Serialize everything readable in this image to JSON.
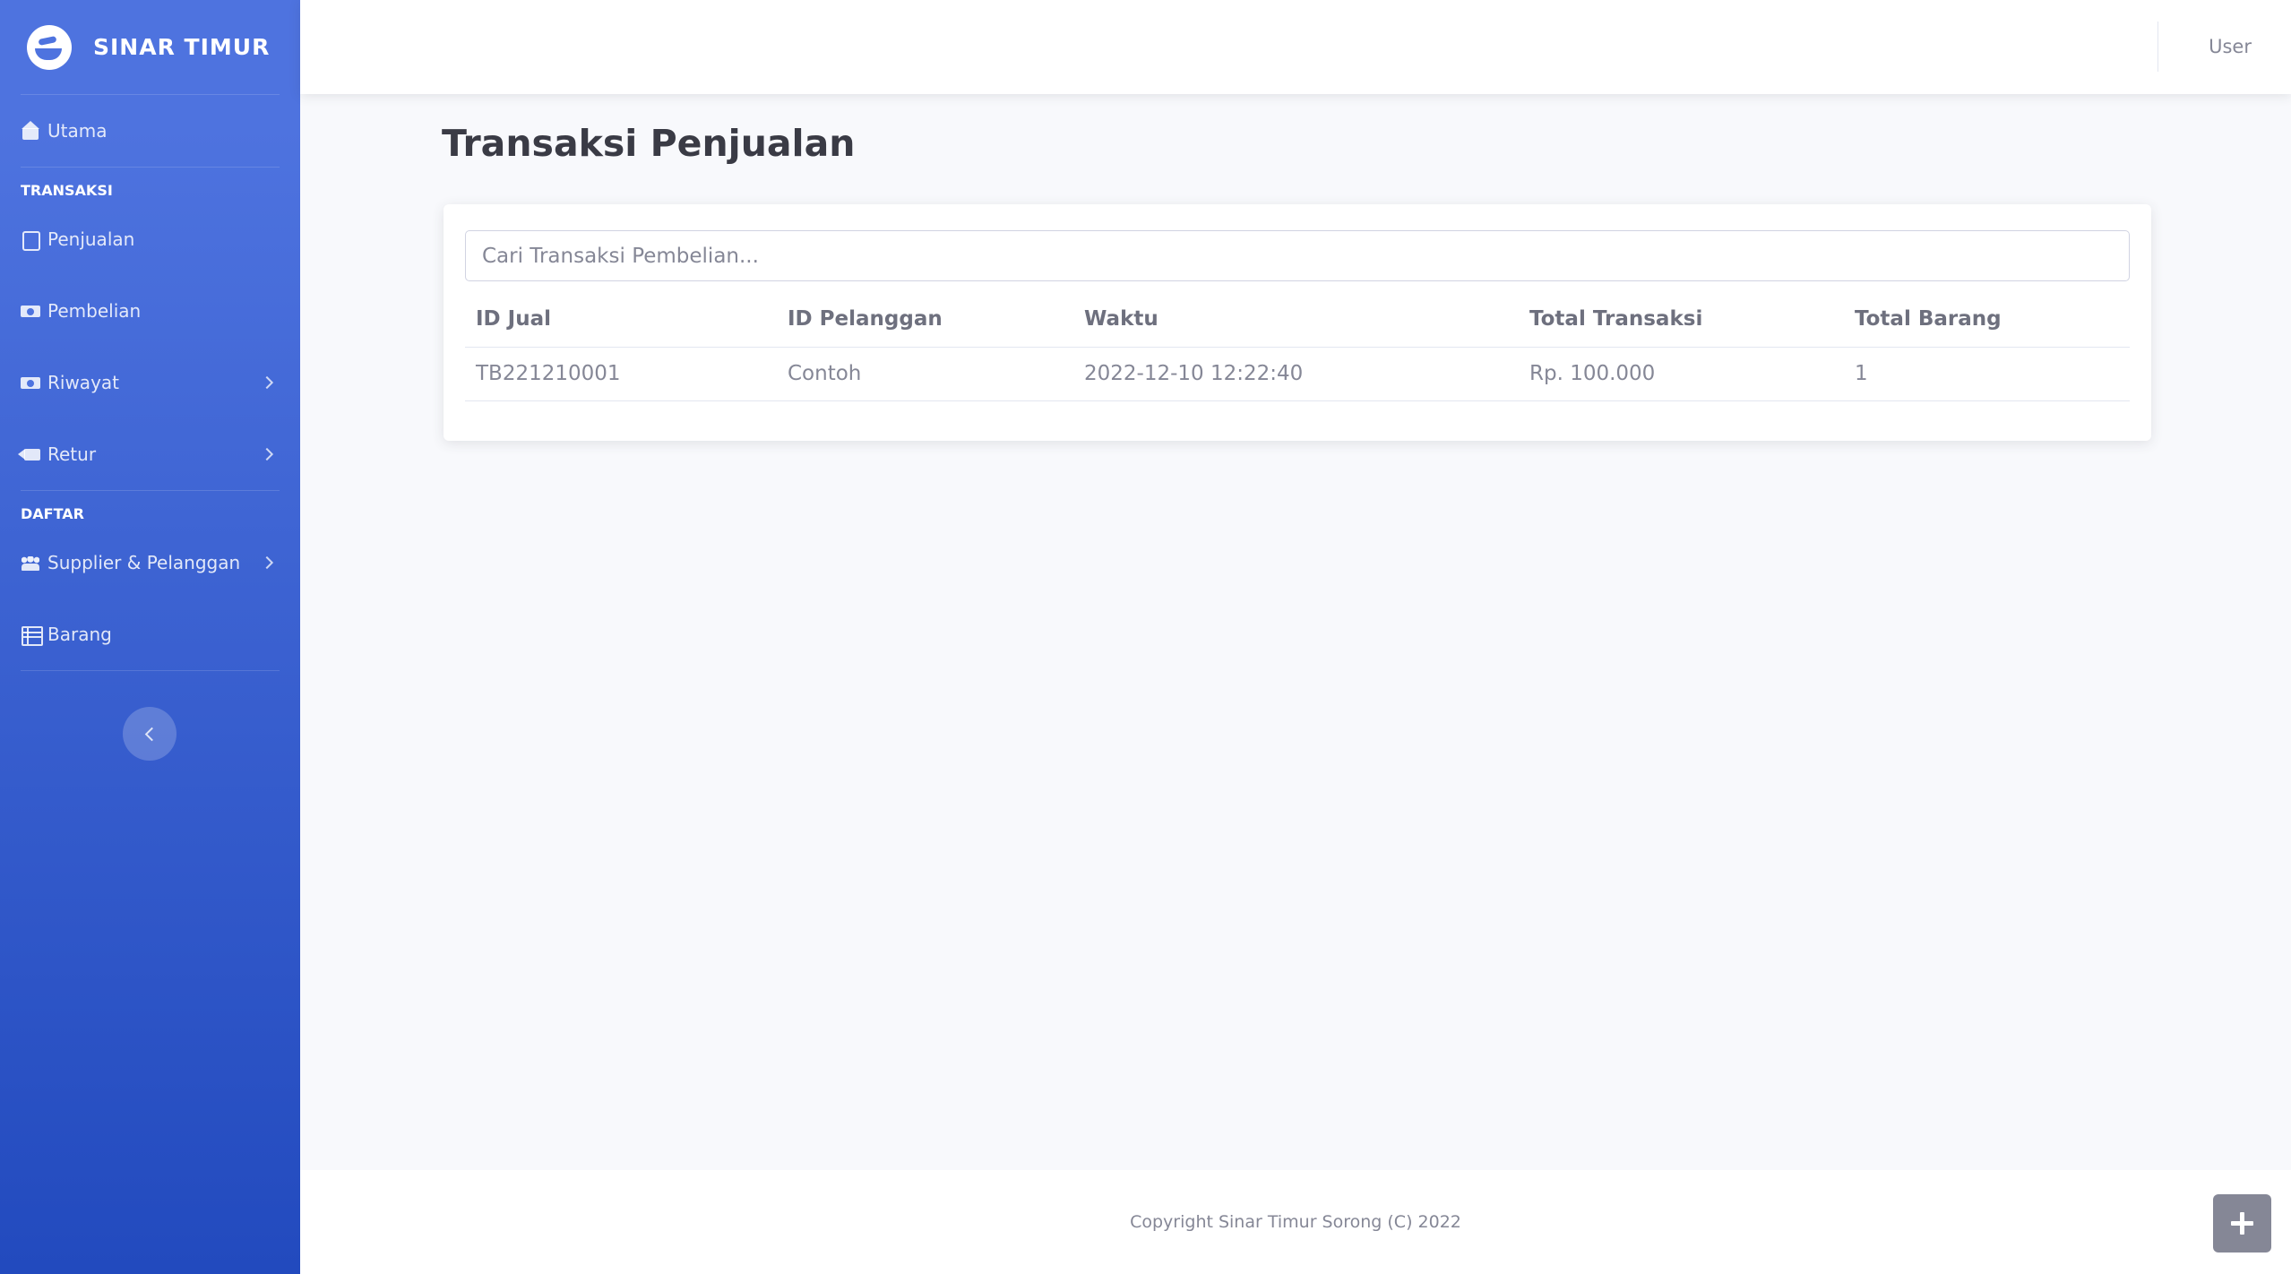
{
  "brand": {
    "name": "SINAR TIMUR"
  },
  "sidebar": {
    "home": {
      "label": "Utama",
      "icon": "home-icon"
    },
    "sections": [
      {
        "heading": "TRANSAKSI",
        "items": [
          {
            "label": "Penjualan",
            "icon": "note-icon",
            "has_submenu": false
          },
          {
            "label": "Pembelian",
            "icon": "money-icon",
            "has_submenu": false
          },
          {
            "label": "Riwayat",
            "icon": "money-icon",
            "has_submenu": true
          },
          {
            "label": "Retur",
            "icon": "backspace-icon",
            "has_submenu": true
          }
        ]
      },
      {
        "heading": "DAFTAR",
        "items": [
          {
            "label": "Supplier & Pelanggan",
            "icon": "users-icon",
            "has_submenu": true
          },
          {
            "label": "Barang",
            "icon": "table-icon",
            "has_submenu": false
          }
        ]
      }
    ]
  },
  "topbar": {
    "user": "User"
  },
  "main": {
    "title": "Transaksi Penjualan",
    "search": {
      "placeholder": "Cari Transaksi Pembelian...",
      "value": ""
    },
    "table": {
      "columns": [
        "ID Jual",
        "ID Pelanggan",
        "Waktu",
        "Total Transaksi",
        "Total Barang"
      ],
      "rows": [
        [
          "TB221210001",
          "Contoh",
          "2022-12-10 12:22:40",
          "Rp. 100.000",
          "1"
        ]
      ]
    }
  },
  "footer": {
    "copyright": "Copyright Sinar Timur Sorong (C) 2022"
  },
  "colors": {
    "sidebar_top": "#4e73df",
    "sidebar_bottom": "#224abe",
    "background": "#f8f9fc",
    "text": "#858796",
    "heading": "#3a3b45"
  }
}
